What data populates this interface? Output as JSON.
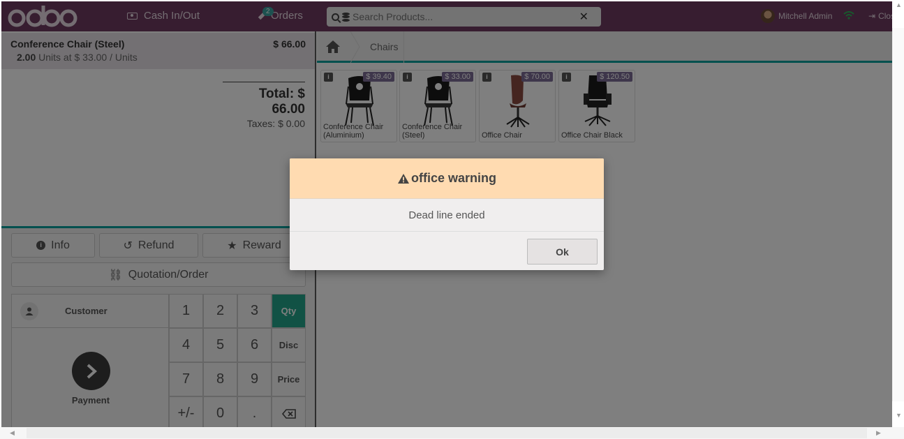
{
  "header": {
    "logo": "odoo",
    "cash_label": "Cash In/Out",
    "orders_label": "Orders",
    "orders_badge": "2",
    "search_placeholder": "Search Products...",
    "user_name": "Mitchell Admin",
    "close_label": "Clos"
  },
  "order": {
    "line": {
      "name": "Conference Chair (Steel)",
      "price": "$ 66.00",
      "qty": "2.00",
      "unit_text": "Units at $ 33.00 / Units"
    },
    "total": "Total: $ 66.00",
    "taxes": "Taxes: $ 0.00"
  },
  "controls": {
    "info": "Info",
    "refund": "Refund",
    "reward": "Reward",
    "quotation": "Quotation/Order",
    "customer": "Customer",
    "payment": "Payment"
  },
  "numpad": {
    "k1": "1",
    "k2": "2",
    "k3": "3",
    "qty": "Qty",
    "k4": "4",
    "k5": "5",
    "k6": "6",
    "disc": "Disc",
    "k7": "7",
    "k8": "8",
    "k9": "9",
    "price": "Price",
    "pm": "+/-",
    "k0": "0",
    "dot": "."
  },
  "breadcrumb": {
    "category": "Chairs"
  },
  "products": [
    {
      "name": "Conference Chair (Aluminium)",
      "price": "$ 39.40"
    },
    {
      "name": "Conference Chair (Steel)",
      "price": "$ 33.00"
    },
    {
      "name": "Office Chair",
      "price": "$ 70.00"
    },
    {
      "name": "Office Chair Black",
      "price": "$ 120.50"
    }
  ],
  "dialog": {
    "title": "office warning",
    "body": "Dead line ended",
    "ok": "Ok"
  },
  "colors": {
    "header": "#6e3b60",
    "accent": "#00a09d",
    "qty_active": "#22a58a",
    "dialog_header": "#ffdbb1"
  }
}
